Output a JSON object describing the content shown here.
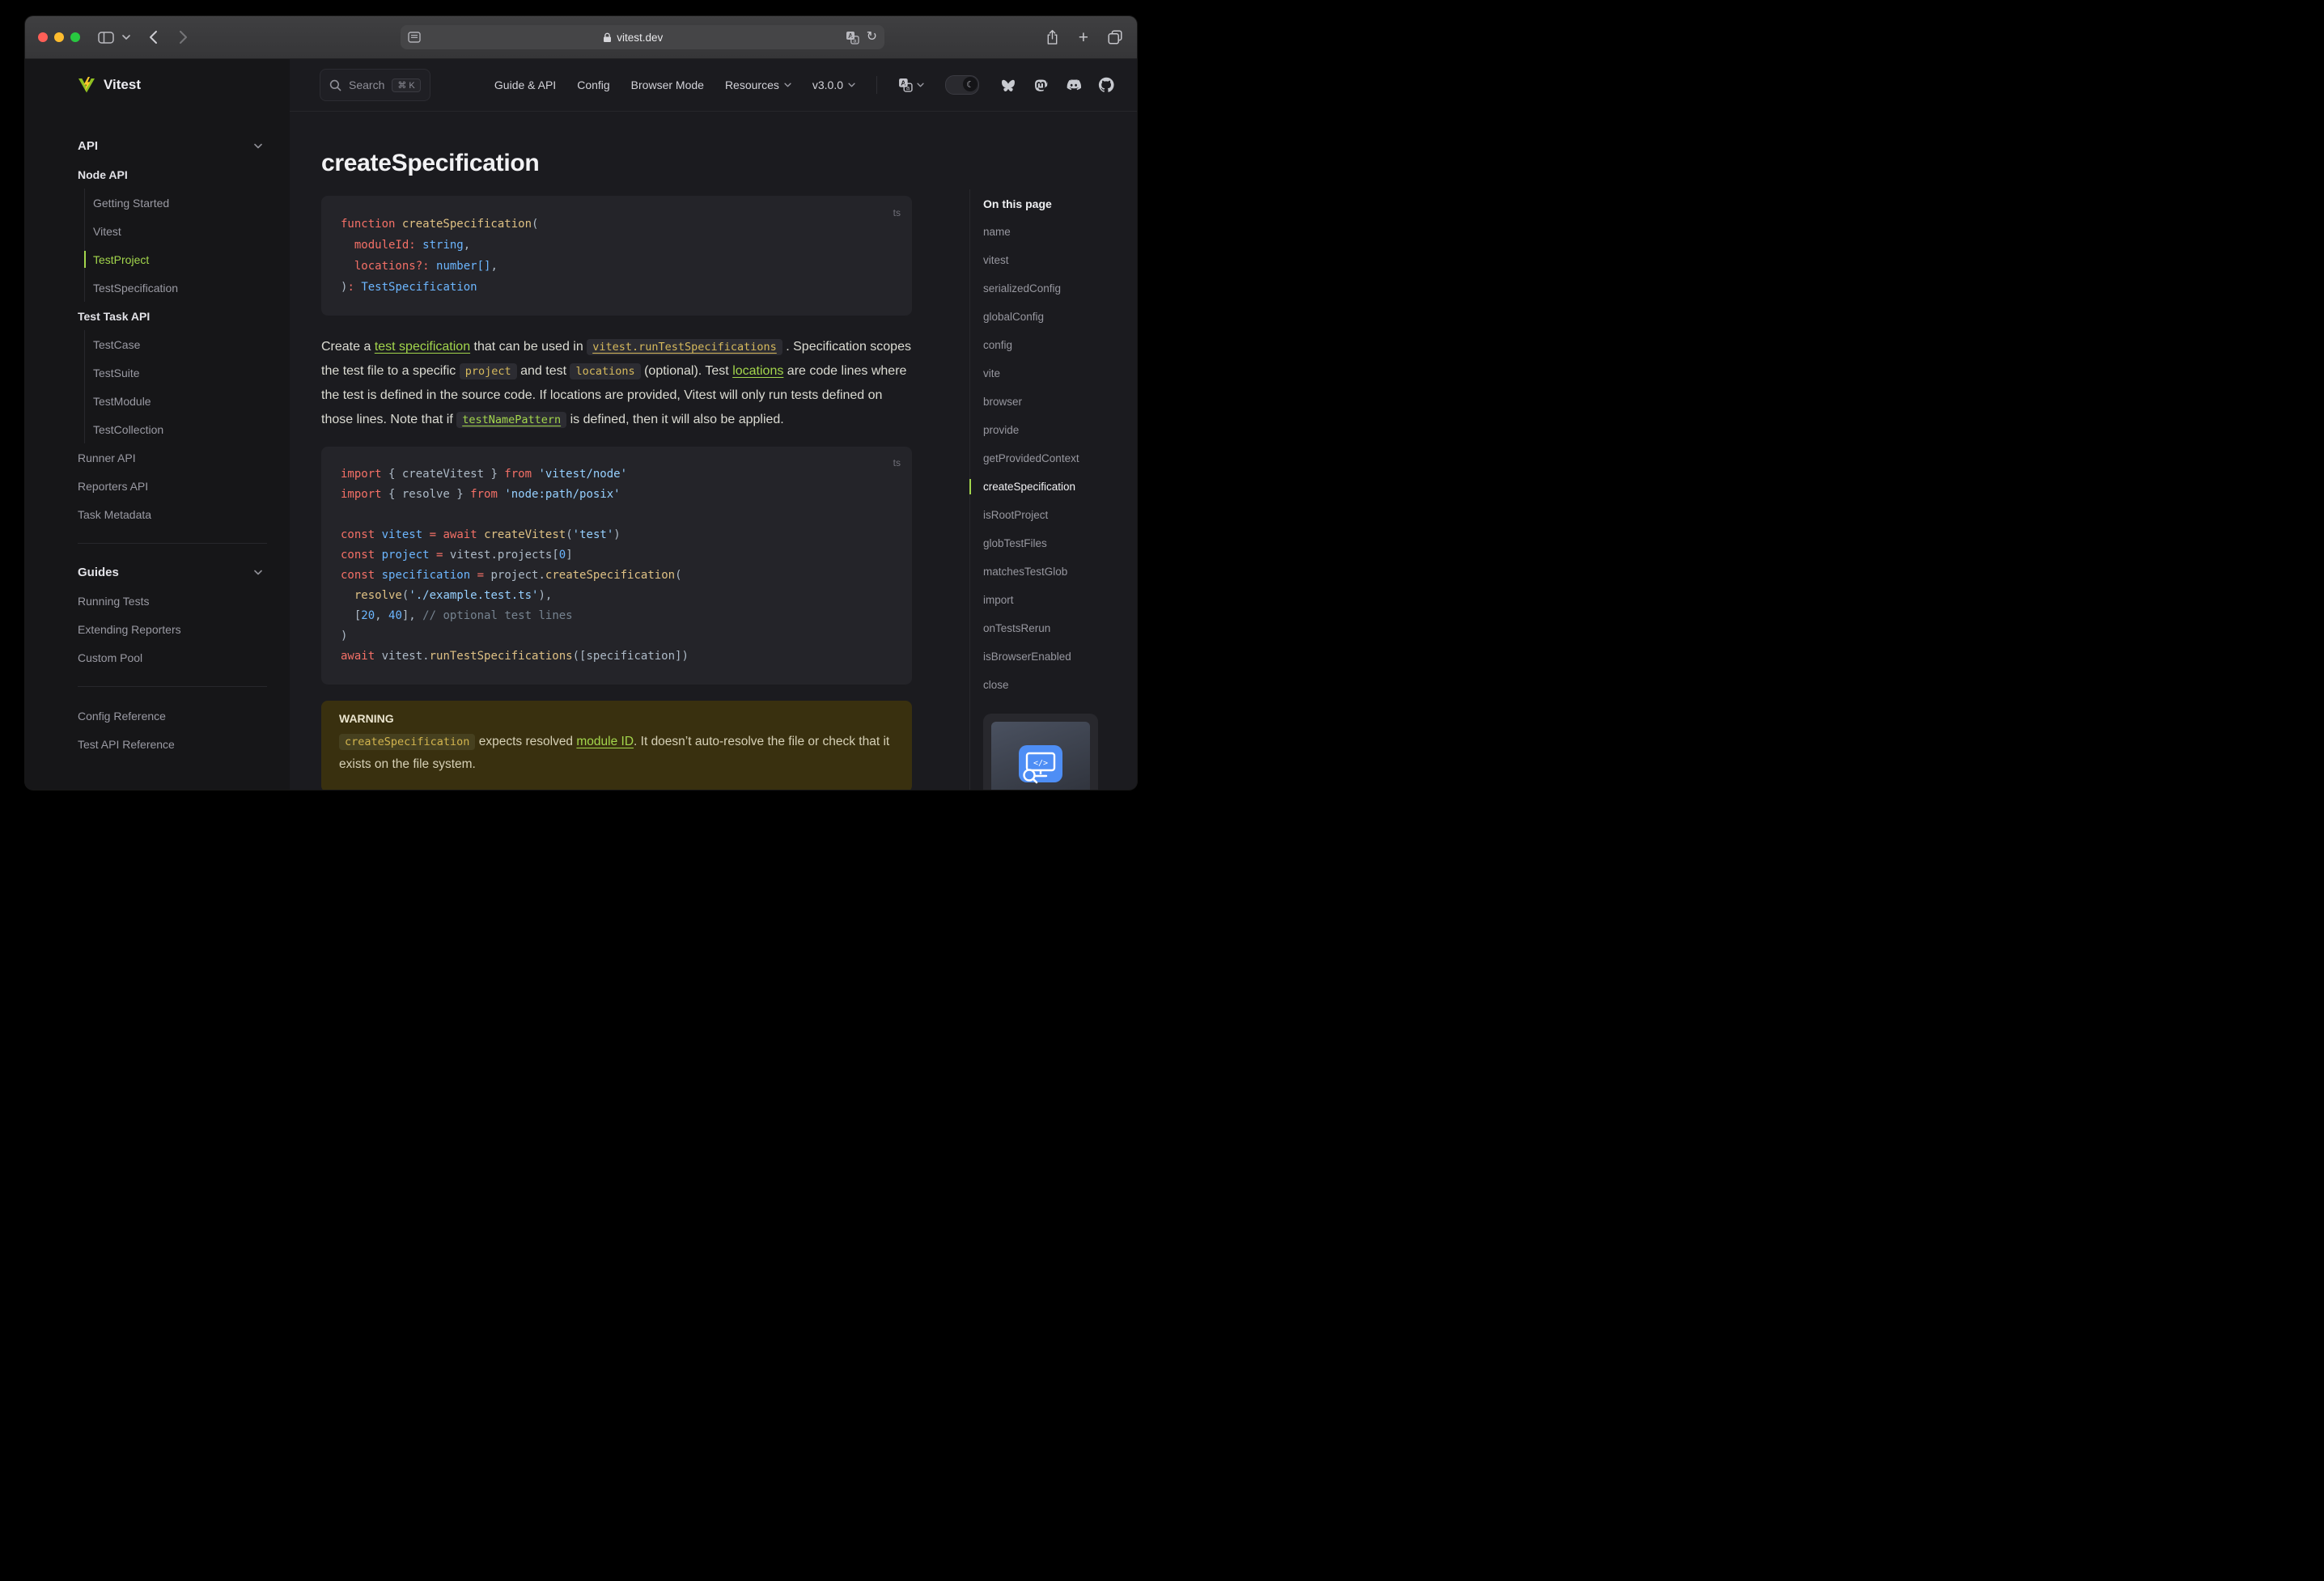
{
  "colors": {
    "accent": "#a3d64c",
    "brand-yellow": "#fcc72b",
    "brand-green": "#8fc021",
    "traffic-red": "#ff5f57",
    "traffic-yellow": "#febc2e",
    "traffic-green": "#28c840",
    "warning-bg": "#39300f",
    "code-amber": "#d6b95c"
  },
  "browser": {
    "url": "vitest.dev",
    "reload_glyph": "↻",
    "new_tab_glyph": "+"
  },
  "navbar": {
    "search_label": "Search",
    "search_kbd": "⌘ K",
    "links": [
      "Guide & API",
      "Config",
      "Browser Mode"
    ],
    "dropdown_resources": "Resources",
    "dropdown_version": "v3.0.0",
    "theme_moon_glyph": "☾"
  },
  "sidebar": {
    "logo": "Vitest",
    "section_api": "API",
    "node_api_label": "Node API",
    "node_api_items": [
      "Getting Started",
      "Vitest",
      "TestProject",
      "TestSpecification"
    ],
    "active_index": 2,
    "test_task_api_label": "Test Task API",
    "test_task_api_items": [
      "TestCase",
      "TestSuite",
      "TestModule",
      "TestCollection"
    ],
    "top_links": [
      "Runner API",
      "Reporters API",
      "Task Metadata"
    ],
    "section_guides": "Guides",
    "guides_links": [
      "Running Tests",
      "Extending Reporters",
      "Custom Pool"
    ],
    "ref_links": [
      "Config Reference",
      "Test API Reference"
    ]
  },
  "main": {
    "title": "createSpecification",
    "code_blocks": [
      {
        "lang": "ts",
        "lines": [
          [
            [
              "k",
              "function "
            ],
            [
              "f",
              "createSpecification"
            ],
            [
              "p",
              "("
            ]
          ],
          [
            [
              "p",
              "  "
            ],
            [
              "k",
              "moduleId:"
            ],
            [
              "p",
              " "
            ],
            [
              "t",
              "string"
            ],
            [
              "p",
              ","
            ]
          ],
          [
            [
              "p",
              "  "
            ],
            [
              "k",
              "locations?:"
            ],
            [
              "p",
              " "
            ],
            [
              "t",
              "number[]"
            ],
            [
              "p",
              ","
            ]
          ],
          [
            [
              "p",
              ")"
            ],
            [
              "k",
              ":"
            ],
            [
              "p",
              " "
            ],
            [
              "t",
              "TestSpecification"
            ]
          ]
        ]
      },
      {
        "lang": "ts",
        "lines": [
          [
            [
              "k",
              "import"
            ],
            [
              "p",
              " { createVitest } "
            ],
            [
              "k",
              "from"
            ],
            [
              "p",
              " "
            ],
            [
              "s",
              "'vitest/node'"
            ]
          ],
          [
            [
              "k",
              "import"
            ],
            [
              "p",
              " { resolve } "
            ],
            [
              "k",
              "from"
            ],
            [
              "p",
              " "
            ],
            [
              "s",
              "'node:path/posix'"
            ]
          ],
          [],
          [
            [
              "k",
              "const"
            ],
            [
              "p",
              " "
            ],
            [
              "v",
              "vitest"
            ],
            [
              "p",
              " "
            ],
            [
              "k",
              "="
            ],
            [
              "p",
              " "
            ],
            [
              "k",
              "await"
            ],
            [
              "p",
              " "
            ],
            [
              "f",
              "createVitest"
            ],
            [
              "p",
              "("
            ],
            [
              "s",
              "'test'"
            ],
            [
              "p",
              ")"
            ]
          ],
          [
            [
              "k",
              "const"
            ],
            [
              "p",
              " "
            ],
            [
              "v",
              "project"
            ],
            [
              "p",
              " "
            ],
            [
              "k",
              "="
            ],
            [
              "p",
              " vitest.projects["
            ],
            [
              "n",
              "0"
            ],
            [
              "p",
              "]"
            ]
          ],
          [
            [
              "k",
              "const"
            ],
            [
              "p",
              " "
            ],
            [
              "v",
              "specification"
            ],
            [
              "p",
              " "
            ],
            [
              "k",
              "="
            ],
            [
              "p",
              " project."
            ],
            [
              "f",
              "createSpecification"
            ],
            [
              "p",
              "("
            ]
          ],
          [
            [
              "p",
              "  "
            ],
            [
              "f",
              "resolve"
            ],
            [
              "p",
              "("
            ],
            [
              "s",
              "'./example.test.ts'"
            ],
            [
              "p",
              "),"
            ]
          ],
          [
            [
              "p",
              "  ["
            ],
            [
              "n",
              "20"
            ],
            [
              "p",
              ", "
            ],
            [
              "n",
              "40"
            ],
            [
              "p",
              "], "
            ],
            [
              "c",
              "// optional test lines"
            ]
          ],
          [
            [
              "p",
              ")"
            ]
          ],
          [
            [
              "k",
              "await"
            ],
            [
              "p",
              " vitest."
            ],
            [
              "f",
              "runTestSpecifications"
            ],
            [
              "p",
              "([specification])"
            ]
          ]
        ]
      }
    ],
    "paragraph": [
      {
        "t": "Create a "
      },
      {
        "t": "test specification",
        "y": "link"
      },
      {
        "t": " that can be used in "
      },
      {
        "t": "vitest.runTestSpecifications",
        "y": "code-link-amber"
      },
      {
        "t": " . Specification scopes the test file to a specific "
      },
      {
        "t": "project",
        "y": "code-amber"
      },
      {
        "t": " and test "
      },
      {
        "t": "locations",
        "y": "code-amber"
      },
      {
        "t": " (optional). Test "
      },
      {
        "t": "locations",
        "y": "link"
      },
      {
        "t": " are code lines where the test is defined in the source code. If locations are provided, Vitest will only run tests defined on those lines. Note that if "
      },
      {
        "t": "testNamePattern",
        "y": "code-link-green"
      },
      {
        "t": " is defined, then it will also be applied."
      }
    ],
    "warning": {
      "label": "WARNING",
      "segments": [
        {
          "t": "createSpecification",
          "y": "code-amber"
        },
        {
          "t": " expects resolved "
        },
        {
          "t": "module ID",
          "y": "link"
        },
        {
          "t": ". It doesn’t auto-resolve the file or check that it exists on the file system."
        }
      ]
    }
  },
  "toc": {
    "title": "On this page",
    "items": [
      "name",
      "vitest",
      "serializedConfig",
      "globalConfig",
      "config",
      "vite",
      "browser",
      "provide",
      "getProvidedContext",
      "createSpecification",
      "isRootProject",
      "globTestFiles",
      "matchesTestGlob",
      "import",
      "onTestsRerun",
      "isBrowserEnabled",
      "close"
    ],
    "active_index": 9
  }
}
